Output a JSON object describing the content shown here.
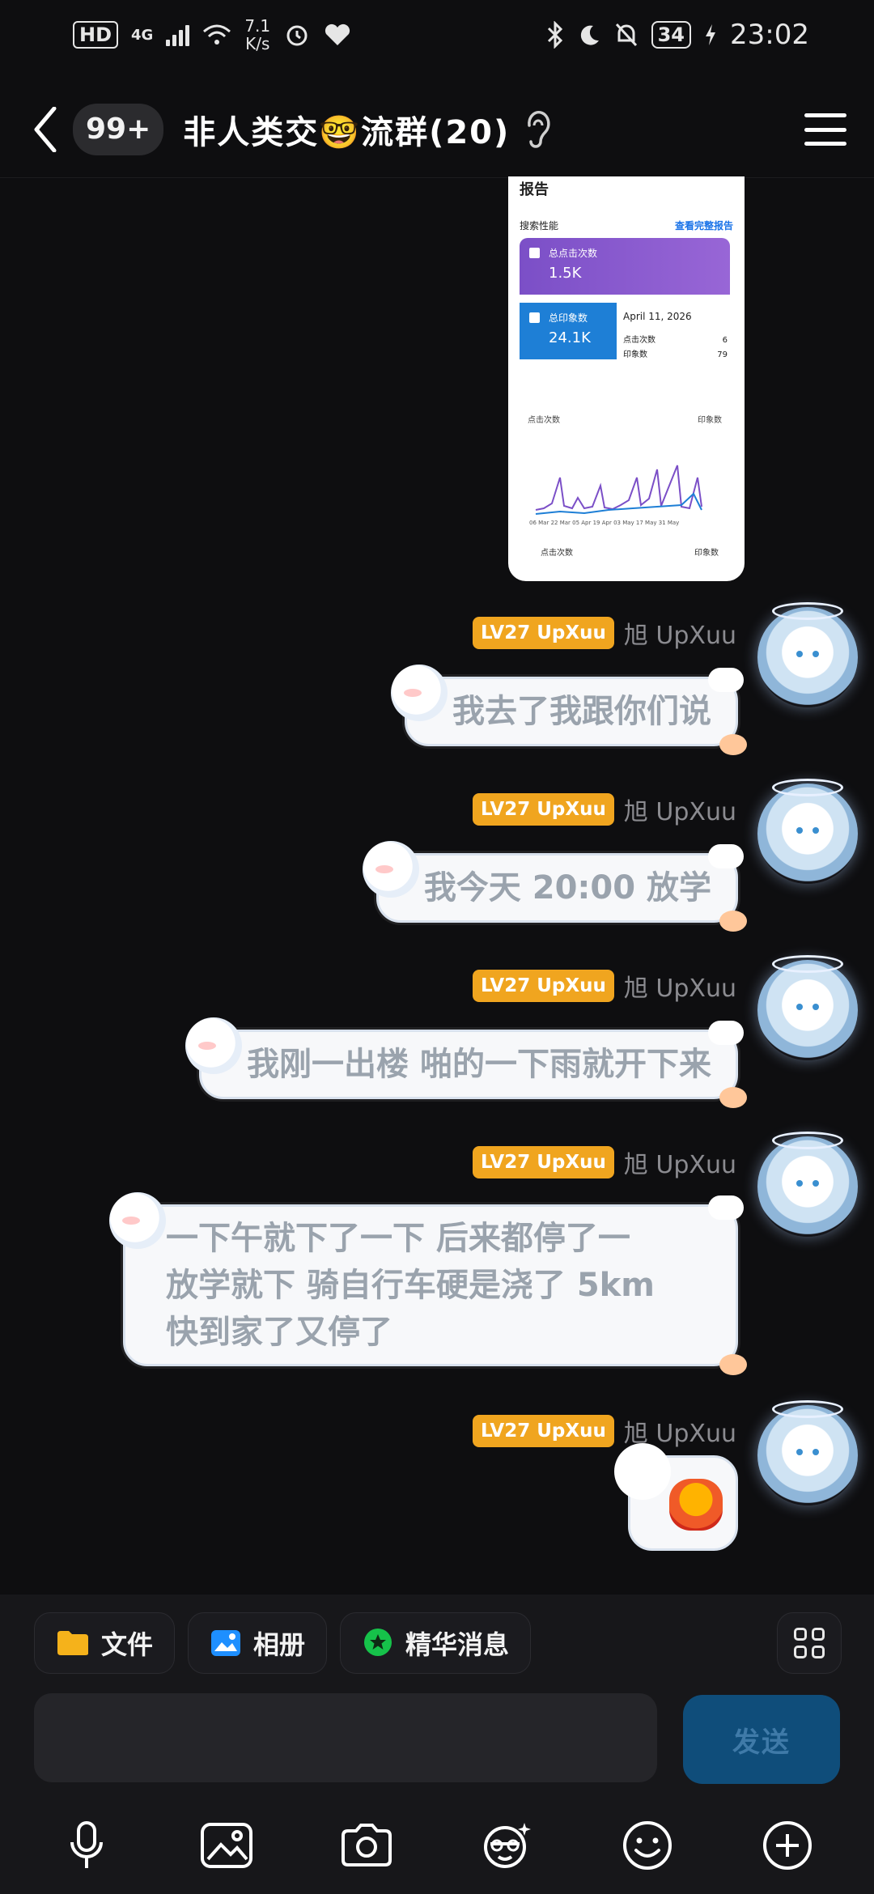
{
  "status_bar": {
    "hd_label": "HD",
    "network_label": "4G",
    "speed_value": "7.1",
    "speed_unit": "K/s",
    "battery": "34",
    "time": "23:02"
  },
  "header": {
    "back_icon": "chevron-left-icon",
    "unread_badge": "99+",
    "title": "非人类交🤓流群(20)",
    "ear_icon": "ear-icon",
    "menu_icon": "hamburger-menu-icon"
  },
  "shared_image": {
    "heading": "报告",
    "section": "搜索性能",
    "link": "查看完整报告",
    "clicks_label": "总点击次数",
    "clicks_value": "1.5K",
    "impressions_label": "总印象数",
    "impressions_value": "24.1K",
    "tooltip_date": "April 11, 2026",
    "tooltip_clicks_label": "点击次数",
    "tooltip_clicks_value": "6",
    "tooltip_impr_label": "印象数",
    "tooltip_impr_value": "79",
    "chart_left_label": "点击次数",
    "chart_right_label": "印象数",
    "x_ticks": "06 Mar 22 Mar 05 Apr 19 Apr 03 May 17 May 31 May",
    "legend_clicks": "点击次数",
    "legend_impr": "印象数"
  },
  "messages": [
    {
      "level": "LV27 UpXuu",
      "nickname": "旭 UpXuu",
      "text": "我去了我跟你们说"
    },
    {
      "level": "LV27 UpXuu",
      "nickname": "旭 UpXuu",
      "text": "我今天 20:00 放学"
    },
    {
      "level": "LV27 UpXuu",
      "nickname": "旭 UpXuu",
      "text": "我刚一出楼 啪的一下雨就开下来"
    },
    {
      "level": "LV27 UpXuu",
      "nickname": "旭 UpXuu",
      "text_lines": [
        "一下午就下了一下 后来都停了一",
        "放学就下 骑自行车硬是浇了 5km",
        "快到家了又停了"
      ]
    },
    {
      "level": "LV27 UpXuu",
      "nickname": "旭 UpXuu",
      "sticker": "angry-emoji-sticker"
    }
  ],
  "quick_actions": {
    "file": "文件",
    "album": "相册",
    "highlights": "精华消息"
  },
  "composer": {
    "send": "发送"
  },
  "toolbar_icons": [
    "microphone-icon",
    "image-icon",
    "camera-icon",
    "face-effect-icon",
    "emoji-icon",
    "plus-circle-icon"
  ],
  "colors": {
    "background": "#0e0e10",
    "level_badge": "#f0a51f",
    "send_button": "#0f4d7a"
  }
}
